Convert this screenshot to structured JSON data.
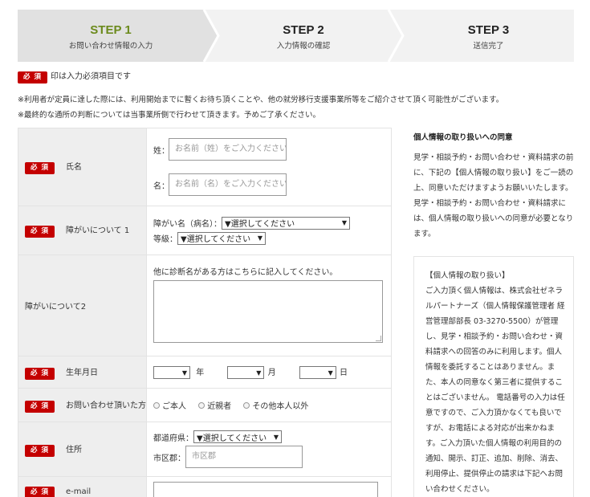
{
  "steps": [
    {
      "title": "STEP 1",
      "subtitle": "お問い合わせ情報の入力"
    },
    {
      "title": "STEP 2",
      "subtitle": "入力情報の確認"
    },
    {
      "title": "STEP 3",
      "subtitle": "送信完了"
    }
  ],
  "required_badge": "必 須",
  "required_note": "印は入力必須項目です",
  "notes": [
    "※利用者が定員に達した際には、利用開始までに暫くお待ち頂くことや、他の就労移行支援事業所等をご紹介させて頂く可能性がございます。",
    "※最終的な通所の判断については当事業所側で行わせて頂きます。予めご了承ください。"
  ],
  "form": {
    "name": {
      "label": "氏名",
      "last_label": "姓：",
      "last_placeholder": "お名前（姓）をご入力ください",
      "first_label": "名：",
      "first_placeholder": "お名前（名）をご入力ください"
    },
    "disability1": {
      "label": "障がいについて 1",
      "name_label": "障がい名（病名）：",
      "name_select": "▼選択してください",
      "grade_label": "等級：",
      "grade_select": "▼選択してください"
    },
    "disability2": {
      "label": "障がいについて2",
      "hint": "他に診断名がある方はこちらに記入してください。"
    },
    "birthday": {
      "label": "生年月日",
      "year_unit": "年",
      "month_unit": "月",
      "day_unit": "日"
    },
    "inquirer": {
      "label": "お問い合わせ頂いた方",
      "options": [
        "ご本人",
        "近親者",
        "その他本人以外"
      ]
    },
    "address": {
      "label": "住所",
      "pref_label": "都道府県：",
      "pref_select": "▼選択してください",
      "city_label": "市区郡：",
      "city_placeholder": "市区郡"
    },
    "email": {
      "label": "e-mail"
    }
  },
  "side": {
    "title": "個人情報の取り扱いへの同意",
    "body": "見学・相談予約・お問い合わせ・資料請求の前に、下記の【個人情報の取り扱い】をご一読の上、同意いただけますようお願いいたします。見学・相談予約・お問い合わせ・資料請求には、個人情報の取り扱いへの同意が必要となります。",
    "policy": "【個人情報の取り扱い】\nご入力頂く個人情報は、株式会社ゼネラルパートナーズ（個人情報保護管理者 経営管理部部長 03-3270-5500）が管理し、見学・相談予約・お問い合わせ・資料請求への回答のみに利用します。個人情報を委託することはありません。また、本人の同意なく第三者に提供することはございません。 電話番号の入力は任意ですので、ご入力頂かなくても良いですが、お電話による対応が出来かねます。ご入力頂いた個人情報の利用目的の通知、開示、訂正、追加、削除、消去、利用停止、提供停止の請求は下記へお問い合わせください。"
  },
  "colors": {
    "accent": "#6b8a1c",
    "badge": "#c40000"
  }
}
